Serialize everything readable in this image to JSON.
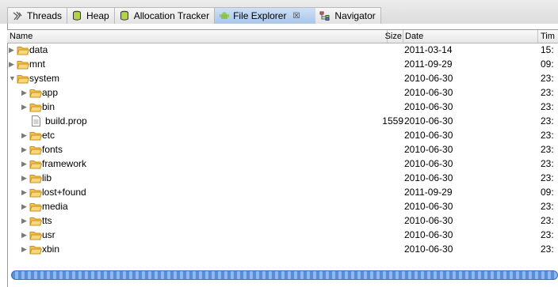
{
  "tabs": [
    {
      "label": "Threads",
      "icon": "threads-icon"
    },
    {
      "label": "Heap",
      "icon": "heap-icon"
    },
    {
      "label": "Allocation Tracker",
      "icon": "allocation-icon"
    },
    {
      "label": "File Explorer",
      "icon": "android-icon",
      "active": true,
      "close": "☒"
    },
    {
      "label": "Navigator",
      "icon": "navigator-icon"
    }
  ],
  "columns": {
    "name": "Name",
    "size": "Size",
    "date": "Date",
    "time": "Tim"
  },
  "rows": [
    {
      "name": "data",
      "type": "folder",
      "level": 0,
      "expanded": false,
      "size": "",
      "date": "2011-03-14",
      "time": "15:"
    },
    {
      "name": "mnt",
      "type": "folder",
      "level": 0,
      "expanded": false,
      "size": "",
      "date": "2011-09-29",
      "time": "09:"
    },
    {
      "name": "system",
      "type": "folder",
      "level": 0,
      "expanded": true,
      "size": "",
      "date": "2010-06-30",
      "time": "23:"
    },
    {
      "name": "app",
      "type": "folder",
      "level": 1,
      "expanded": false,
      "size": "",
      "date": "2010-06-30",
      "time": "23:"
    },
    {
      "name": "bin",
      "type": "folder",
      "level": 1,
      "expanded": false,
      "size": "",
      "date": "2010-06-30",
      "time": "23:"
    },
    {
      "name": "build.prop",
      "type": "file",
      "level": 1,
      "expanded": false,
      "size": "1559",
      "date": "2010-06-30",
      "time": "23:"
    },
    {
      "name": "etc",
      "type": "folder",
      "level": 1,
      "expanded": false,
      "size": "",
      "date": "2010-06-30",
      "time": "23:"
    },
    {
      "name": "fonts",
      "type": "folder",
      "level": 1,
      "expanded": false,
      "size": "",
      "date": "2010-06-30",
      "time": "23:"
    },
    {
      "name": "framework",
      "type": "folder",
      "level": 1,
      "expanded": false,
      "size": "",
      "date": "2010-06-30",
      "time": "23:"
    },
    {
      "name": "lib",
      "type": "folder",
      "level": 1,
      "expanded": false,
      "size": "",
      "date": "2010-06-30",
      "time": "23:"
    },
    {
      "name": "lost+found",
      "type": "folder",
      "level": 1,
      "expanded": false,
      "size": "",
      "date": "2011-09-29",
      "time": "09:"
    },
    {
      "name": "media",
      "type": "folder",
      "level": 1,
      "expanded": false,
      "size": "",
      "date": "2010-06-30",
      "time": "23:"
    },
    {
      "name": "tts",
      "type": "folder",
      "level": 1,
      "expanded": false,
      "size": "",
      "date": "2010-06-30",
      "time": "23:"
    },
    {
      "name": "usr",
      "type": "folder",
      "level": 1,
      "expanded": false,
      "size": "",
      "date": "2010-06-30",
      "time": "23:"
    },
    {
      "name": "xbin",
      "type": "folder",
      "level": 1,
      "expanded": false,
      "size": "",
      "date": "2010-06-30",
      "time": "23:"
    }
  ],
  "colors": {
    "folder": "#f2c14e",
    "folder_dark": "#c9931c",
    "active_tab": "#a9c6ec",
    "android": "#8bc34a",
    "scroll": "#5a8fd8"
  }
}
